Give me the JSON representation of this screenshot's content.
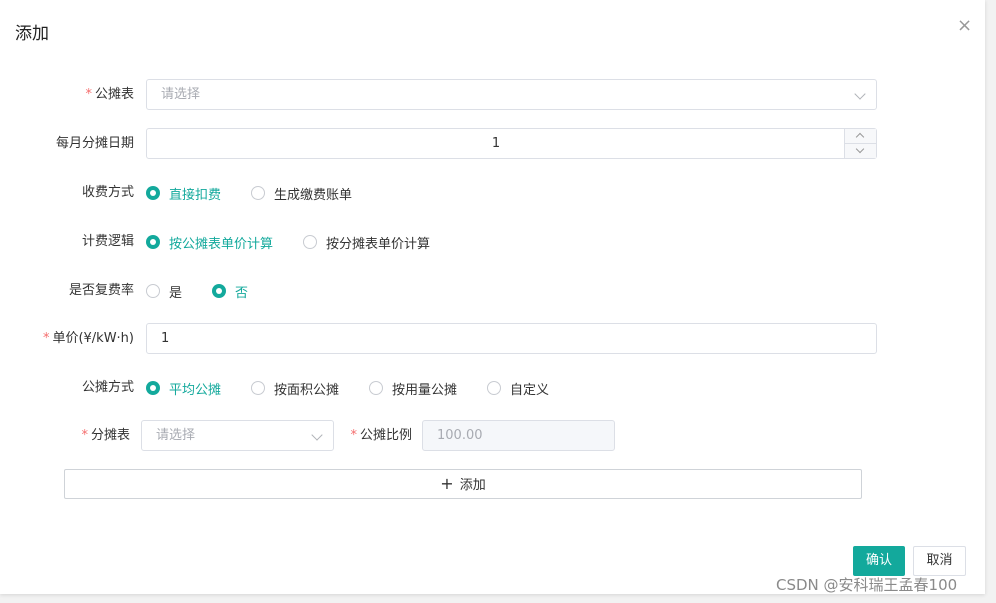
{
  "dialog": {
    "title": "添加",
    "close_glyph": "×"
  },
  "form": {
    "share_table": {
      "label": "公摊表",
      "placeholder": "请选择"
    },
    "monthly_day": {
      "label": "每月分摊日期",
      "value": "1"
    },
    "charge_method": {
      "label": "收费方式",
      "options": [
        "直接扣费",
        "生成缴费账单"
      ],
      "selected": "直接扣费"
    },
    "billing_logic": {
      "label": "计费逻辑",
      "options": [
        "按公摊表单价计算",
        "按分摊表单价计算"
      ],
      "selected": "按公摊表单价计算"
    },
    "compound_rate": {
      "label": "是否复费率",
      "options": [
        "是",
        "否"
      ],
      "selected": "否"
    },
    "unit_price": {
      "label": "单价(¥/kW·h)",
      "value": "1"
    },
    "share_method": {
      "label": "公摊方式",
      "options": [
        "平均公摊",
        "按面积公摊",
        "按用量公摊",
        "自定义"
      ],
      "selected": "平均公摊"
    },
    "sub_table": {
      "label": "分摊表",
      "placeholder": "请选择"
    },
    "share_ratio": {
      "label": "公摊比例",
      "value": "100.00"
    },
    "add_row": {
      "icon": "+",
      "label": "添加"
    }
  },
  "footer": {
    "confirm_label": "确认",
    "cancel_label": "取消"
  },
  "watermark": "CSDN @安科瑞王孟春100",
  "colors": {
    "accent": "#13a99c",
    "required": "#f56c6c",
    "border": "#dcdfe6"
  }
}
